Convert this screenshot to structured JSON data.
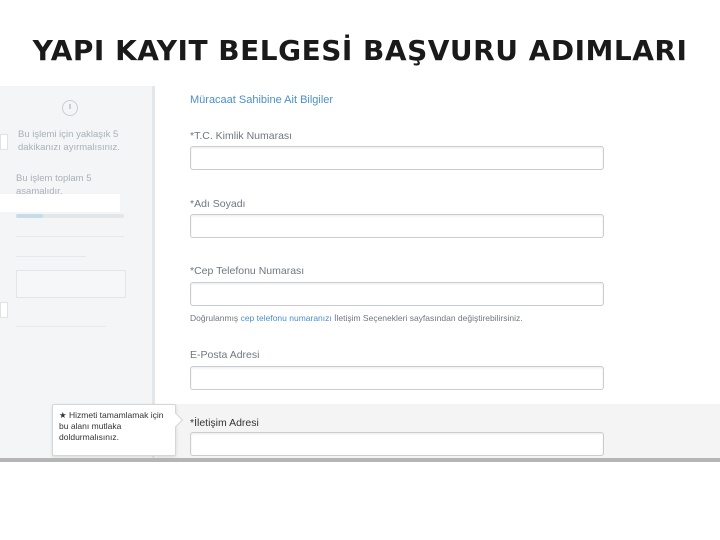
{
  "slide": {
    "title": "YAPI KAYIT BELGESİ BAŞVURU ADIMLARI"
  },
  "sidebar": {
    "duration_note": "Bu işlemi için yaklaşık 5 dakikanızı ayırmalısınız.",
    "steps_note": "Bu işlem toplam 5 aşamalıdır.",
    "progress_fraction": 0.25
  },
  "form": {
    "section_title": "Müracaat Sahibine Ait Bilgiler",
    "fields": [
      {
        "label": "*T.C. Kimlik Numarası",
        "value": ""
      },
      {
        "label": "*Adı Soyadı",
        "value": ""
      },
      {
        "label": "*Cep Telefonu Numarası",
        "value": ""
      },
      {
        "label": "E-Posta Adresi",
        "value": ""
      },
      {
        "label": "*İletişim Adresi",
        "value": ""
      }
    ],
    "phone_hint_prefix": "Doğrulanmış ",
    "phone_hint_link1": "cep telefonu numaranızı",
    "phone_hint_middle": " İletişim Seçenekleri sayfasından değiştirebilirsiniz.",
    "tooltip": "★ Hizmeti tamamlamak için bu alanı mutlaka doldurmalısınız."
  },
  "colors": {
    "accent": "#4a90c8",
    "sidebar_bg": "#f3f5f7"
  }
}
